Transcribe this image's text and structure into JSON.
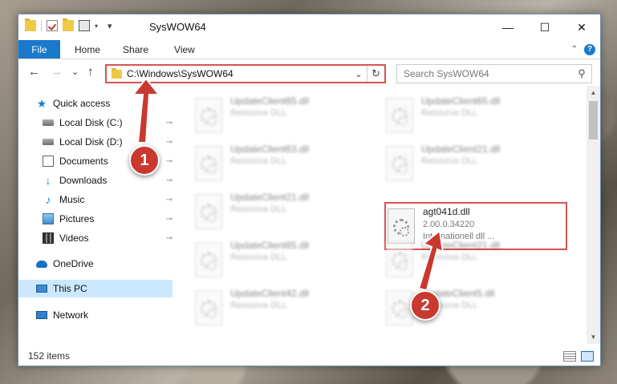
{
  "window": {
    "title": "SysWOW64",
    "controls": {
      "minimize": "—",
      "maximize": "☐",
      "close": "✕"
    }
  },
  "quick_access_toolbar": {
    "dropdown": "▾",
    "title_dropdown": "▾"
  },
  "ribbon": {
    "tabs": [
      {
        "label": "File"
      },
      {
        "label": "Home"
      },
      {
        "label": "Share"
      },
      {
        "label": "View"
      }
    ],
    "collapse": "⌃",
    "help": "?"
  },
  "nav": {
    "back": "←",
    "forward": "→",
    "recent": "⌄",
    "up": "↑",
    "address": "C:\\Windows\\SysWOW64",
    "address_dropdown": "⌄",
    "refresh": "↻",
    "search_placeholder": "Search SysWOW64",
    "search_icon": "⚲"
  },
  "sidebar": {
    "items": [
      {
        "label": "Quick access",
        "icon": "star-icon",
        "pinned": false
      },
      {
        "label": "Local Disk (C:)",
        "icon": "disk-icon",
        "pinned": true
      },
      {
        "label": "Local Disk (D:)",
        "icon": "disk-icon",
        "pinned": true
      },
      {
        "label": "Documents",
        "icon": "document-icon",
        "pinned": true
      },
      {
        "label": "Downloads",
        "icon": "download-icon",
        "pinned": true
      },
      {
        "label": "Music",
        "icon": "music-icon",
        "pinned": true
      },
      {
        "label": "Pictures",
        "icon": "pictures-icon",
        "pinned": true
      },
      {
        "label": "Videos",
        "icon": "videos-icon",
        "pinned": true
      },
      {
        "label": "OneDrive",
        "icon": "cloud-icon",
        "pinned": false
      },
      {
        "label": "This PC",
        "icon": "pc-icon",
        "pinned": false,
        "selected": true
      },
      {
        "label": "Network",
        "icon": "network-icon",
        "pinned": false
      }
    ],
    "pin_glyph": "📌"
  },
  "files": [
    {
      "name": "UpdateClient65.dll",
      "sub": "Resource DLL",
      "blurred": true
    },
    {
      "name": "UpdateClient65.dll",
      "sub": "Resource DLL",
      "blurred": true
    },
    {
      "name": "UpdateClient63.dll",
      "sub": "Resource DLL",
      "blurred": true
    },
    {
      "name": "UpdateClient21.dll",
      "sub": "Resource DLL",
      "blurred": true
    },
    {
      "name": "UpdateClient21.dll",
      "sub": "Resource DLL",
      "blurred": true
    },
    {
      "name": "agt041d.dll",
      "sub": "2.00.0.34220",
      "sub2": "Internationell dll ...",
      "blurred": false
    },
    {
      "name": "UpdateClient65.dll",
      "sub": "Resource DLL",
      "blurred": true
    },
    {
      "name": "UpdateClient21.dll",
      "sub": "Resource DLL",
      "blurred": true
    },
    {
      "name": "UpdateClient42.dll",
      "sub": "Resource DLL",
      "blurred": true
    },
    {
      "name": "UpdateClient5.dll",
      "sub": "Resource DLL",
      "blurred": true
    }
  ],
  "scrollbar": {
    "up": "▲",
    "down": "▼"
  },
  "status": {
    "item_count": "152 items"
  },
  "annotations": {
    "callout_1": "1",
    "callout_2": "2",
    "color": "#c9392f"
  },
  "colors": {
    "accent": "#1979ca",
    "highlight_box": "#d9534f",
    "selected_nav": "#cce8ff"
  }
}
